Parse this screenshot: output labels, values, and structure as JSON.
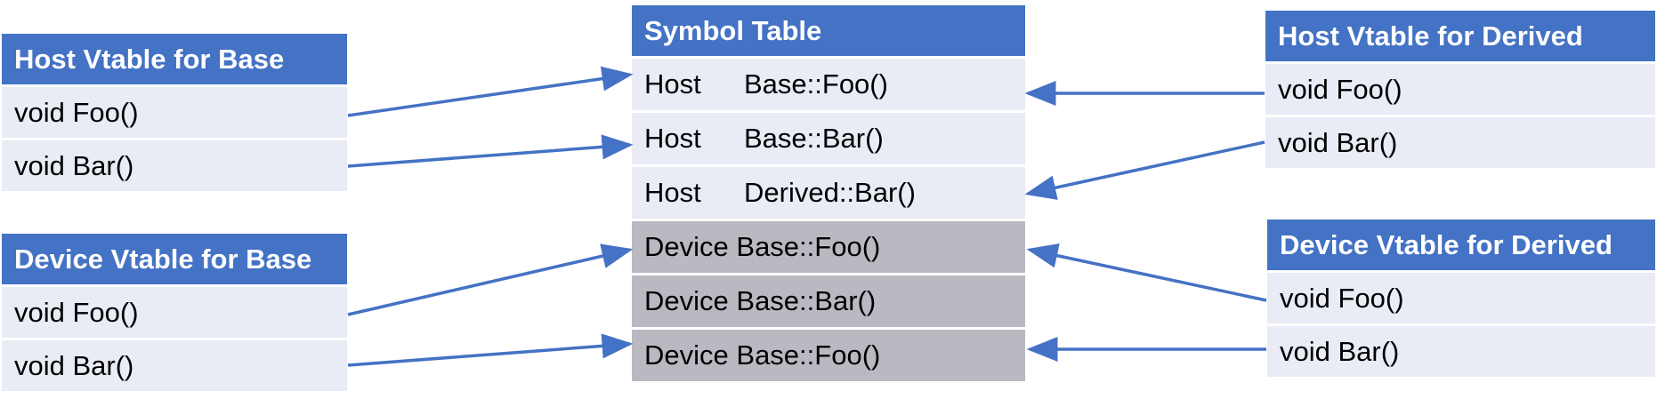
{
  "colors": {
    "header": "#4472c4",
    "row_light": "#e9ebf5",
    "row_device": "#b9b9c2",
    "arrow": "#4472c4"
  },
  "host_base": {
    "title": "Host Vtable for Base",
    "rows": [
      "void Foo()",
      "void Bar()"
    ]
  },
  "device_base": {
    "title": "Device Vtable for Base",
    "rows": [
      "void Foo()",
      "void Bar()"
    ]
  },
  "symbol_table": {
    "title": "Symbol Table",
    "rows": [
      {
        "kind": "Host",
        "symbol": "Base::Foo()"
      },
      {
        "kind": "Host",
        "symbol": "Base::Bar()"
      },
      {
        "kind": "Host",
        "symbol": "Derived::Bar()"
      },
      {
        "kind": "Device",
        "symbol": "Base::Foo()"
      },
      {
        "kind": "Device",
        "symbol": "Base::Bar()"
      },
      {
        "kind": "Device",
        "symbol": "Base::Foo()"
      }
    ]
  },
  "host_derived": {
    "title": "Host Vtable for Derived",
    "rows": [
      "void Foo()",
      "void Bar()"
    ]
  },
  "device_derived": {
    "title": "Device Vtable for Derived",
    "rows": [
      "void Foo()",
      "void Bar()"
    ]
  }
}
